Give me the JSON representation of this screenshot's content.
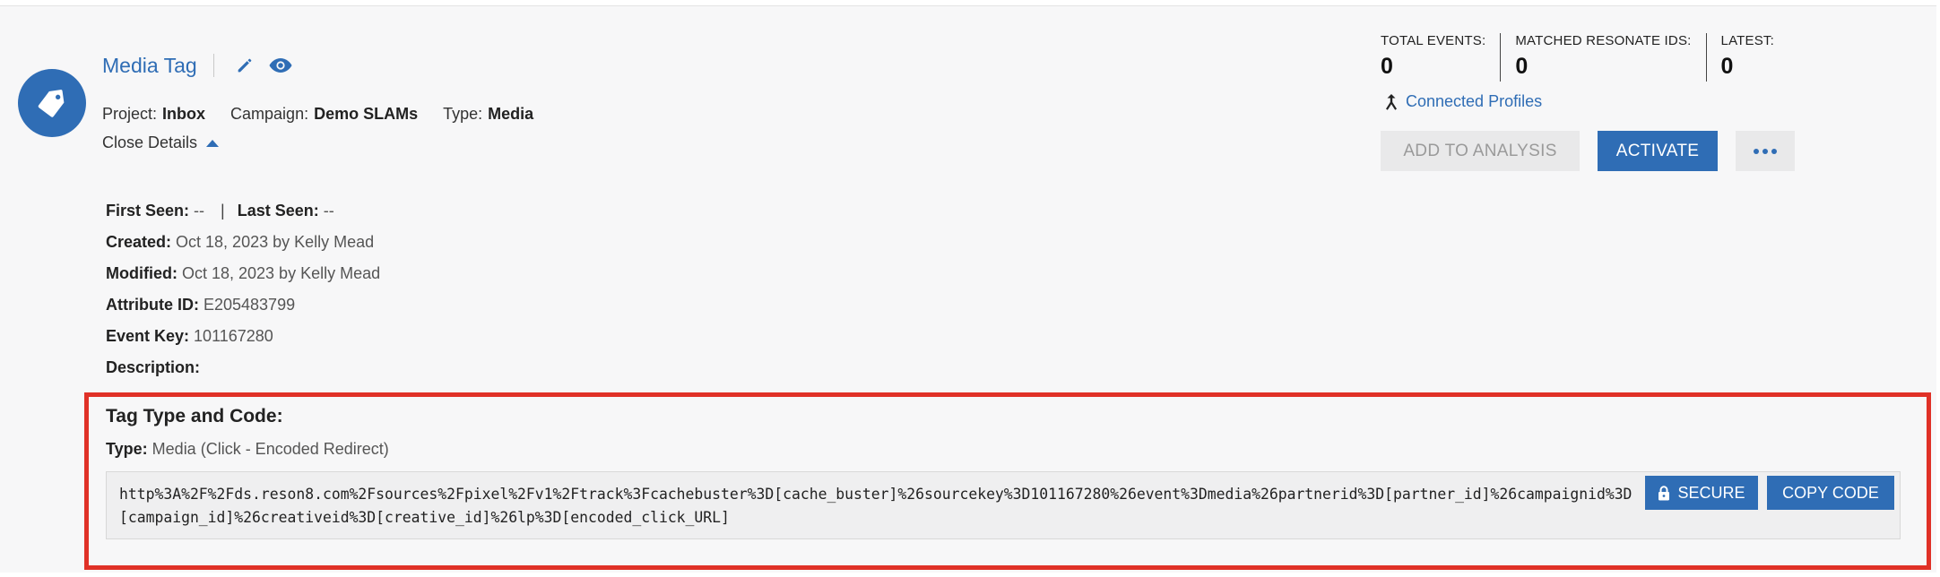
{
  "header": {
    "title": "Media Tag",
    "meta": [
      {
        "label": "Project:",
        "value": "Inbox"
      },
      {
        "label": "Campaign:",
        "value": "Demo SLAMs"
      },
      {
        "label": "Type:",
        "value": "Media"
      }
    ],
    "close_details": "Close Details"
  },
  "details": {
    "first_seen_label": "First Seen:",
    "first_seen_value": "--",
    "separator": "|",
    "last_seen_label": "Last Seen:",
    "last_seen_value": "--",
    "created_label": "Created:",
    "created_value": "Oct 18, 2023 by Kelly Mead",
    "modified_label": "Modified:",
    "modified_value": "Oct 18, 2023 by Kelly Mead",
    "attribute_id_label": "Attribute ID:",
    "attribute_id_value": "E205483799",
    "event_key_label": "Event Key:",
    "event_key_value": "101167280",
    "description_label": "Description:",
    "description_value": ""
  },
  "stats": [
    {
      "label": "TOTAL EVENTS:",
      "value": "0"
    },
    {
      "label": "MATCHED RESONATE IDS:",
      "value": "0"
    },
    {
      "label": "LATEST:",
      "value": "0"
    }
  ],
  "connected_profiles": "Connected Profiles",
  "actions": {
    "add_to_analysis": "ADD TO ANALYSIS",
    "activate": "ACTIVATE"
  },
  "tag_code": {
    "title": "Tag Type and Code:",
    "type_label": "Type:",
    "type_value": "Media (Click - Encoded Redirect)",
    "code": "http%3A%2F%2Fds.reson8.com%2Fsources%2Fpixel%2Fv1%2Ftrack%3Fcachebuster%3D[cache_buster]%26sourcekey%3D101167280%26event%3Dmedia%26partnerid%3D[partner_id]%26campaignid%3D[campaign_id]%26creativeid%3D[creative_id]%26lp%3D[encoded_click_URL]",
    "secure_label": "SECURE",
    "copy_label": "COPY CODE"
  },
  "colors": {
    "accent": "#2f6db5",
    "highlight_border": "#e03127",
    "disabled_button": "#e9e9ea"
  },
  "icons": {
    "avatar": "tag-icon",
    "edit": "pencil-icon",
    "view": "eye-icon",
    "connected": "merge-arrow-icon",
    "secure": "lock-icon",
    "more": "ellipsis-icon"
  }
}
